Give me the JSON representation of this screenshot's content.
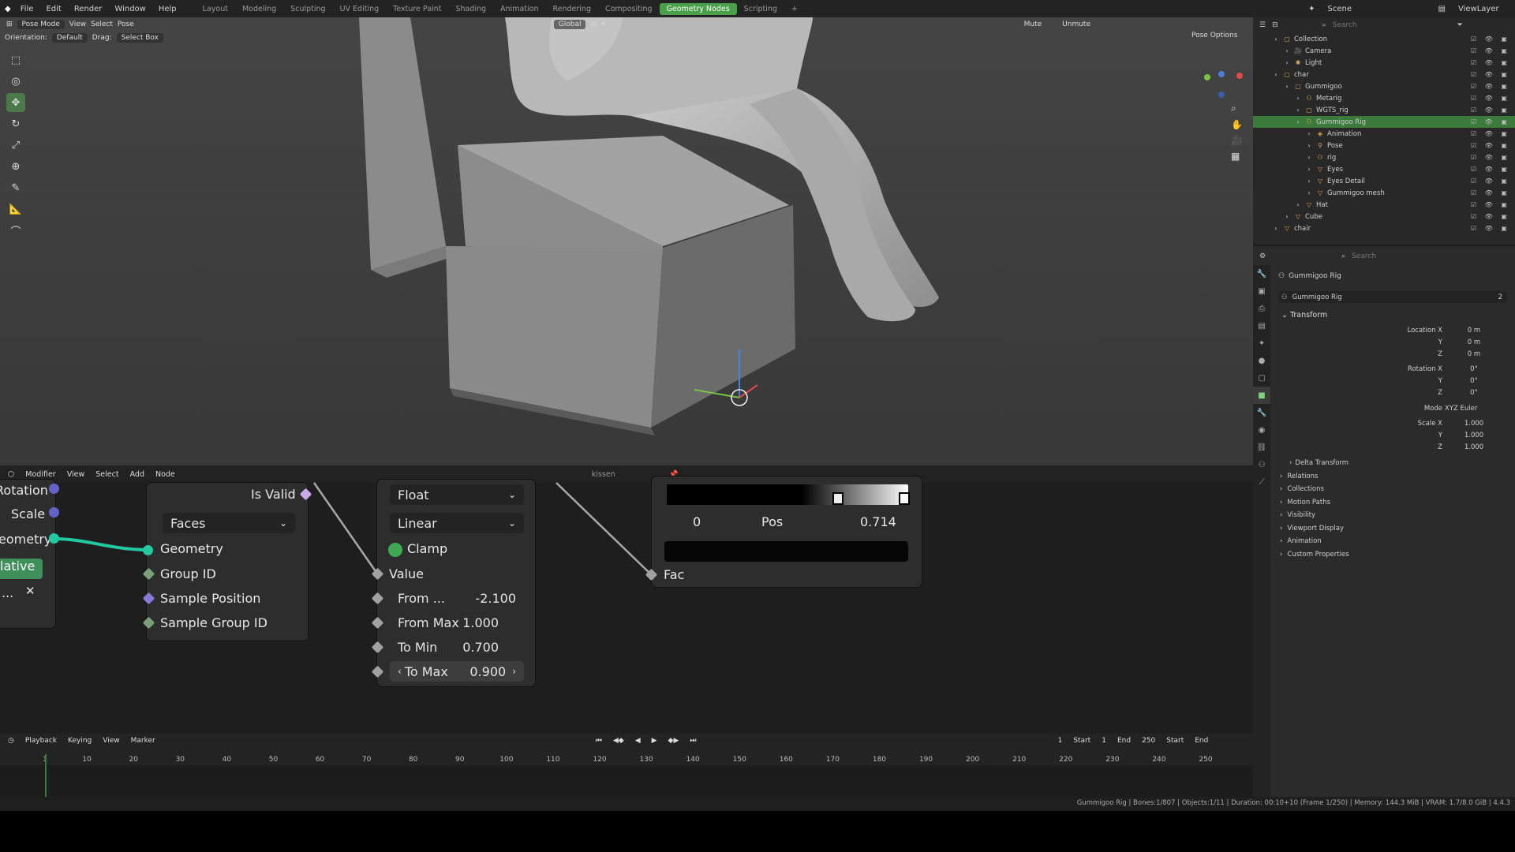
{
  "topbar": {
    "menus": [
      "File",
      "Edit",
      "Render",
      "Window",
      "Help"
    ],
    "workspaces": [
      "Layout",
      "Modeling",
      "Sculpting",
      "UV Editing",
      "Texture Paint",
      "Shading",
      "Animation",
      "Rendering",
      "Compositing",
      "Geometry Nodes",
      "Scripting",
      "+"
    ],
    "active_workspace": "Geometry Nodes",
    "scene": "Scene",
    "view_layer": "ViewLayer"
  },
  "viewport": {
    "mode": "Pose Mode",
    "menus": [
      "View",
      "Select",
      "Pose"
    ],
    "orientation_label": "Orientation:",
    "orientation_value": "Default",
    "drag_label": "Drag:",
    "drag_value": "Select Box",
    "transform_space": "Global",
    "mute": "Mute",
    "unmute": "Unmute",
    "pose_options": "Pose Options"
  },
  "outliner": {
    "search_placeholder": "Search",
    "items": [
      {
        "label": "Collection",
        "indent": 0,
        "icon": "collection-icon"
      },
      {
        "label": "Camera",
        "indent": 1,
        "icon": "camera-icon"
      },
      {
        "label": "Light",
        "indent": 1,
        "icon": "light-icon"
      },
      {
        "label": "char",
        "indent": 0,
        "icon": "collection-icon"
      },
      {
        "label": "Gummigoo",
        "indent": 1,
        "icon": "collection-icon"
      },
      {
        "label": "Metarig",
        "indent": 2,
        "icon": "armature-icon"
      },
      {
        "label": "WGTS_rig",
        "indent": 2,
        "icon": "collection-icon"
      },
      {
        "label": "Gummigoo Rig",
        "indent": 2,
        "icon": "armature-icon",
        "selected": true
      },
      {
        "label": "Animation",
        "indent": 3,
        "icon": "animation-icon"
      },
      {
        "label": "Pose",
        "indent": 3,
        "icon": "pose-icon"
      },
      {
        "label": "rig",
        "indent": 3,
        "icon": "armature-icon"
      },
      {
        "label": "Eyes",
        "indent": 3,
        "icon": "mesh-icon"
      },
      {
        "label": "Eyes Detail",
        "indent": 3,
        "icon": "mesh-icon"
      },
      {
        "label": "Gummigoo mesh",
        "indent": 3,
        "icon": "mesh-icon"
      },
      {
        "label": "Hat",
        "indent": 2,
        "icon": "mesh-icon"
      },
      {
        "label": "Cube",
        "indent": 1,
        "icon": "mesh-icon"
      },
      {
        "label": "chair",
        "indent": 0,
        "icon": "mesh-icon"
      }
    ]
  },
  "properties": {
    "search_placeholder": "Search",
    "object_name": "Gummigoo Rig",
    "datablock_name": "Gummigoo Rig",
    "user_count": "2",
    "transform_header": "Transform",
    "location_label": "Location X",
    "location": [
      "0 m",
      "0 m",
      "0 m"
    ],
    "rotation_label": "Rotation X",
    "rotation": [
      "0°",
      "0°",
      "0°"
    ],
    "mode_label": "Mode",
    "mode_value": "XYZ Euler",
    "scale_label": "Scale X",
    "scale": [
      "1.000",
      "1.000",
      "1.000"
    ],
    "axis_y": "Y",
    "axis_z": "Z",
    "delta_transform": "Delta Transform",
    "panels": [
      "Relations",
      "Collections",
      "Motion Paths",
      "Visibility",
      "Viewport Display",
      "Animation",
      "Custom Properties"
    ]
  },
  "node_editor": {
    "menus": [
      "Modifier",
      "View",
      "Select",
      "Add",
      "Node"
    ],
    "node_tree": "kissen",
    "frag_rotation": "Rotation",
    "frag_scale": "Scale",
    "frag_geometry": "eometry",
    "frag_relative": "lative",
    "frag_dots": "...",
    "node1": {
      "is_valid": "Is Valid",
      "domain": "Faces",
      "geometry": "Geometry",
      "group_id": "Group ID",
      "sample_position": "Sample Position",
      "sample_group_id": "Sample Group ID"
    },
    "map_range": {
      "data_type": "Float",
      "interpolation": "Linear",
      "clamp": "Clamp",
      "value": "Value",
      "from_min_label": "From ...",
      "from_min": "-2.100",
      "from_max_label": "From Max",
      "from_max": "1.000",
      "to_min_label": "To Min",
      "to_min": "0.700",
      "to_max_label": "To Max",
      "to_max": "0.900"
    },
    "color_ramp": {
      "index": "0",
      "pos_label": "Pos",
      "pos": "0.714",
      "fac": "Fac"
    }
  },
  "timeline": {
    "menus": [
      "Playback",
      "Keying",
      "View",
      "Marker"
    ],
    "current_frame": "1",
    "start_label": "Start",
    "start": "1",
    "end_label": "End",
    "end": "250",
    "start2": "Start",
    "end2": "End",
    "ticks": [
      "1",
      "10",
      "20",
      "30",
      "40",
      "50",
      "60",
      "70",
      "80",
      "90",
      "100",
      "110",
      "120",
      "130",
      "140",
      "150",
      "160",
      "170",
      "180",
      "190",
      "200",
      "210",
      "220",
      "230",
      "240",
      "250"
    ]
  },
  "status": "Gummigoo Rig | Bones:1/807 | Objects:1/11 | Duration: 00:10+10 (Frame 1/250) | Memory: 144.3 MiB | VRAM: 1.7/8.0 GiB | 4.4.3",
  "colors": {
    "accent": "#4a9f4a",
    "geometry_socket": "#00d6a3",
    "vector_socket": "#6363c7",
    "int_socket": "#598c5c",
    "float_socket": "#a1a1a1"
  }
}
